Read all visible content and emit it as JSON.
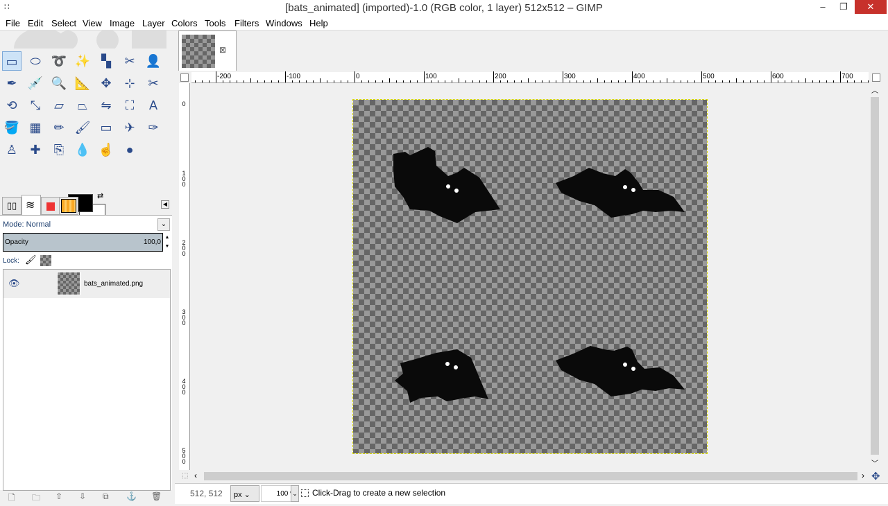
{
  "window": {
    "title": "[bats_animated] (imported)-1.0 (RGB color, 1 layer) 512x512 – GIMP",
    "minimize": "–",
    "maximize": "❐",
    "close": "✕"
  },
  "menu": [
    "File",
    "Edit",
    "Select",
    "View",
    "Image",
    "Layer",
    "Colors",
    "Tools",
    "Filters",
    "Windows",
    "Help"
  ],
  "tools": [
    "rect-select",
    "ellipse-select",
    "free-select",
    "fuzzy-select",
    "select-by-color",
    "scissors",
    "foreground-select",
    "paths",
    "color-picker",
    "zoom",
    "measure",
    "move",
    "align",
    "crop",
    "rotate",
    "scale",
    "shear",
    "perspective",
    "flip",
    "cage",
    "text",
    "bucket-fill",
    "blend",
    "pencil",
    "paintbrush",
    "eraser",
    "airbrush",
    "ink",
    "clone",
    "heal",
    "perspective-clone",
    "blur",
    "smudge",
    "dodge-burn"
  ],
  "colors": {
    "foreground": "#000000",
    "background": "#ffffff",
    "accent": "#cde3f7"
  },
  "layers_panel": {
    "mode_label": "Mode: Normal",
    "opacity_label": "Opacity",
    "opacity_value": "100,0",
    "lock_label": "Lock:",
    "layers": [
      {
        "name": "bats_animated.png",
        "visible": true
      }
    ]
  },
  "image_tab": {
    "close": "⊠"
  },
  "rulers": {
    "h": [
      "-200",
      "-100",
      "0",
      "100",
      "200",
      "300",
      "400",
      "500",
      "600",
      "700"
    ],
    "v": [
      "0",
      "100",
      "200",
      "300",
      "400",
      "500"
    ]
  },
  "status": {
    "coords": "512, 512",
    "unit": "px",
    "zoom": "100 %",
    "message": "Click-Drag to create a new selection"
  }
}
